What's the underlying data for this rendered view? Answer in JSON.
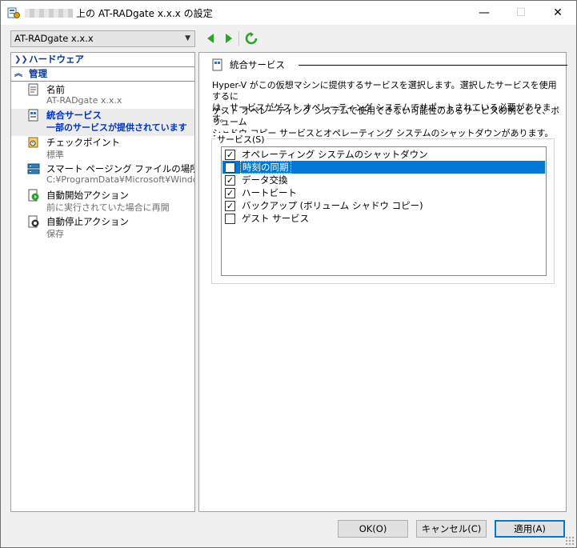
{
  "window": {
    "title": "上の AT-RADgate x.x.x の設定",
    "controls": {
      "minimize": "—",
      "maximize": "☐",
      "close": "✕"
    }
  },
  "toolbar": {
    "vm_selector": "AT-RADgate x.x.x",
    "back_icon": "green-left-arrow-icon",
    "forward_icon": "green-right-arrow-icon",
    "refresh_icon": "green-refresh-icon"
  },
  "sidebar": {
    "sections": [
      {
        "label": "ハードウェア",
        "state": "collapsed"
      },
      {
        "label": "管理",
        "state": "expanded"
      }
    ],
    "items": [
      {
        "label": "名前",
        "sub": "AT-RADgate x.x.x",
        "icon": "name-doc-icon"
      },
      {
        "label": "統合サービス",
        "sub": "一部のサービスが提供されています",
        "icon": "integration-services-icon",
        "selected": true
      },
      {
        "label": "チェックポイント",
        "sub": "標準",
        "icon": "checkpoint-icon"
      },
      {
        "label": "スマート ページング ファイルの場所",
        "sub": "C:¥ProgramData¥Microsoft¥Windo...",
        "icon": "paging-file-icon"
      },
      {
        "label": "自動開始アクション",
        "sub": "前に実行されていた場合に再開",
        "icon": "auto-start-icon"
      },
      {
        "label": "自動停止アクション",
        "sub": "保存",
        "icon": "auto-stop-icon"
      }
    ]
  },
  "panel": {
    "title": "統合サービス",
    "desc1_line1": "Hyper-V がこの仮想マシンに提供するサービスを選択します。選択したサービスを使用するに",
    "desc1_line2": "は、サービスがゲスト オペレーティング システムでサポートされている必要があります。",
    "desc2_line1": "ゲスト オペレーティング システムで使用できない可能性のあるサービスの例として、ボリューム",
    "desc2_line2": "シャドウ コピー サービスとオペレーティング システムのシャットダウンがあります。",
    "group_label": "サービス(S)",
    "services": [
      {
        "label": "オペレーティング システムのシャットダウン",
        "checked": true
      },
      {
        "label": "時刻の同期",
        "checked": false,
        "selected": true
      },
      {
        "label": "データ交換",
        "checked": true
      },
      {
        "label": "ハートビート",
        "checked": true
      },
      {
        "label": "バックアップ (ボリューム シャドウ コピー)",
        "checked": true
      },
      {
        "label": "ゲスト サービス",
        "checked": false
      }
    ]
  },
  "buttons": {
    "ok": "OK(O)",
    "cancel": "キャンセル(C)",
    "apply": "適用(A)"
  },
  "colors": {
    "accent": "#0078d7",
    "section_head": "#0033aa",
    "selected_text": "#0033cc",
    "nav_green": "#2aa52a"
  }
}
